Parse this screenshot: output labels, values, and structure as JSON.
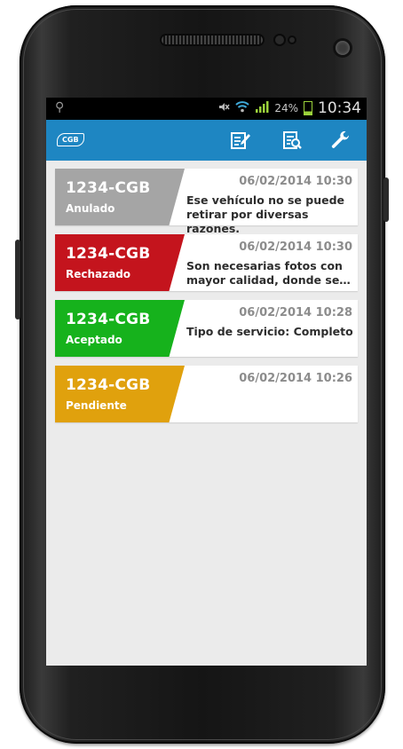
{
  "status_bar": {
    "battery_percent": "24%",
    "time": "10:34",
    "icons": [
      "usb-icon",
      "mute-icon",
      "wifi-icon",
      "signal-icon",
      "battery-icon"
    ]
  },
  "app_bar": {
    "logo": "CGB",
    "actions": [
      "edit-note-icon",
      "document-search-icon",
      "wrench-icon"
    ],
    "color": "#1e86c2"
  },
  "items": [
    {
      "plate": "1234-CGB",
      "status": "Anulado",
      "date": "06/02/2014 10:30",
      "message": "Ese vehículo no se puede retirar por diversas razones.",
      "color": "#a5a5a5"
    },
    {
      "plate": "1234-CGB",
      "status": "Rechazado",
      "date": "06/02/2014 10:30",
      "message": "Son necesarias fotos con mayor calidad, donde se…",
      "color": "#c4141d"
    },
    {
      "plate": "1234-CGB",
      "status": "Aceptado",
      "date": "06/02/2014 10:28",
      "message": "Tipo de servicio: Completo",
      "color": "#16b21c"
    },
    {
      "plate": "1234-CGB",
      "status": "Pendiente",
      "date": "06/02/2014 10:26",
      "message": "",
      "color": "#e0a10d"
    }
  ]
}
